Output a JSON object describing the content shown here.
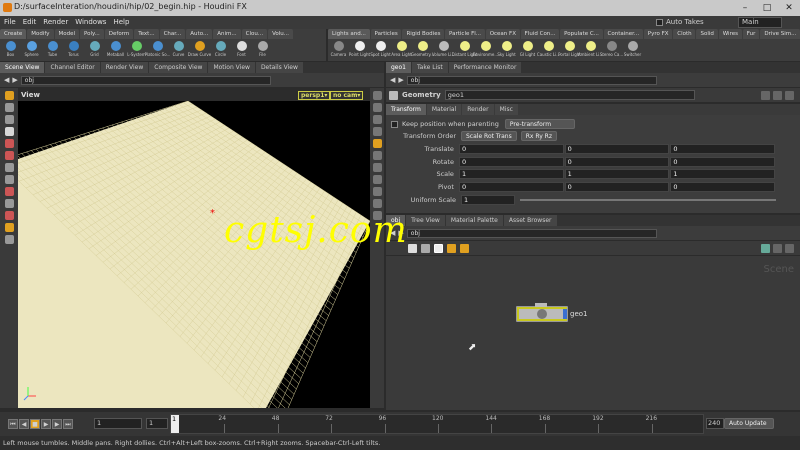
{
  "window": {
    "title": "D:/surfaceInteration/houdini/hip/02_begin.hip - Houdini FX"
  },
  "menu": [
    "File",
    "Edit",
    "Render",
    "Windows",
    "Help"
  ],
  "takes": {
    "label": "Auto Takes",
    "desk": "Main"
  },
  "shelf_left": {
    "tabs": [
      "Create",
      "Modify",
      "Model",
      "Poly...",
      "Deform",
      "Text...",
      "Char...",
      "Auto...",
      "Anim...",
      "Clou...",
      "Volu..."
    ],
    "tools": [
      "Box",
      "Sphere",
      "Tube",
      "Torus",
      "Grid",
      "Metaball",
      "L-System",
      "Platonic So...",
      "Curve",
      "Draw Curve",
      "Circle",
      "Font",
      "File"
    ]
  },
  "shelf_right": {
    "tabs": [
      "Lights and...",
      "Particles",
      "Rigid Bodies",
      "Particle Fl...",
      "Ocean FX",
      "Fluid Con...",
      "Populate C...",
      "Container...",
      "Pyro FX",
      "Cloth",
      "Solid",
      "Wires",
      "Fur",
      "Drive Sim..."
    ],
    "tools": [
      "Camera",
      "Point Light",
      "Spot Light",
      "Area Light",
      "Geometry...",
      "Volume Li...",
      "Distant Light",
      "Environme...",
      "Sky Light",
      "GI Light",
      "Caustic Li...",
      "Portal Light",
      "Ambient Li...",
      "Stereo Ca...",
      "Switcher"
    ]
  },
  "left_pane": {
    "tabs": [
      "Scene View",
      "Channel Editor",
      "Render View",
      "Composite View",
      "Motion View",
      "Details View"
    ],
    "path": "obj",
    "view_label": "View",
    "persp": "persp1▾",
    "cam": "no cam▾"
  },
  "right_top": {
    "tabs": [
      "geo1",
      "Take List",
      "Performance Monitor"
    ],
    "path": "obj",
    "node_type": "Geometry",
    "node_name": "geo1",
    "param_tabs": [
      "Transform",
      "Material",
      "Render",
      "Misc"
    ],
    "keep_position": "Keep position when parenting",
    "keep_value": "Pre-transform",
    "transform_order_label": "Transform Order",
    "transform_order": "Scale Rot Trans",
    "rot_order": "Rx Ry Rz",
    "params": [
      {
        "label": "Translate",
        "values": [
          "0",
          "0",
          "0"
        ]
      },
      {
        "label": "Rotate",
        "values": [
          "0",
          "0",
          "0"
        ]
      },
      {
        "label": "Scale",
        "values": [
          "1",
          "1",
          "1"
        ]
      },
      {
        "label": "Pivot",
        "values": [
          "0",
          "0",
          "0"
        ]
      }
    ],
    "uniform_scale": {
      "label": "Uniform Scale",
      "value": "1"
    }
  },
  "right_bottom": {
    "tabs": [
      "obj",
      "Tree View",
      "Material Palette",
      "Asset Browser"
    ],
    "path": "obj",
    "scene_label": "Scene",
    "node": {
      "name": "geo1"
    }
  },
  "timeline": {
    "start": "1",
    "current": "1",
    "frame": "1",
    "ticks": [
      "24",
      "48",
      "72",
      "96",
      "120",
      "144",
      "168",
      "192",
      "216"
    ],
    "end": "240",
    "auto_update": "Auto Update"
  },
  "status": "Left mouse tumbles. Middle pans. Right dollies. Ctrl+Alt+Left box-zooms. Ctrl+Right zooms. Spacebar-Ctrl-Left tilts.",
  "watermark": "cgtsj.com",
  "colors": {
    "accent": "#e07a10",
    "grid": "#ece6bf",
    "node": "#c8c820"
  }
}
